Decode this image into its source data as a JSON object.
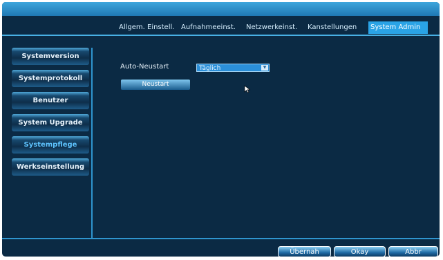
{
  "tabs": [
    "Allgem. Einstell.",
    "Aufnahmeeinst.",
    "Netzwerkeinst.",
    "Kanstellungen",
    "System Admin"
  ],
  "active_tab": "System Admin",
  "sidebar": {
    "items": [
      "Systemversion",
      "Systemprotokoll",
      "Benutzer",
      "System Upgrade",
      "Systempflege",
      "Werkseinstellung"
    ],
    "selected": "Systempflege"
  },
  "main": {
    "auto_restart_label": "Auto-Neustart",
    "auto_restart_value": "Täglich",
    "restart_button": "Neustart"
  },
  "footer": {
    "apply": "Übernah",
    "ok": "Okay",
    "cancel": "Abbr"
  },
  "colors": {
    "background": "#0b2a44",
    "accent": "#2aa3e6",
    "selected_text": "#5ec4ff"
  }
}
